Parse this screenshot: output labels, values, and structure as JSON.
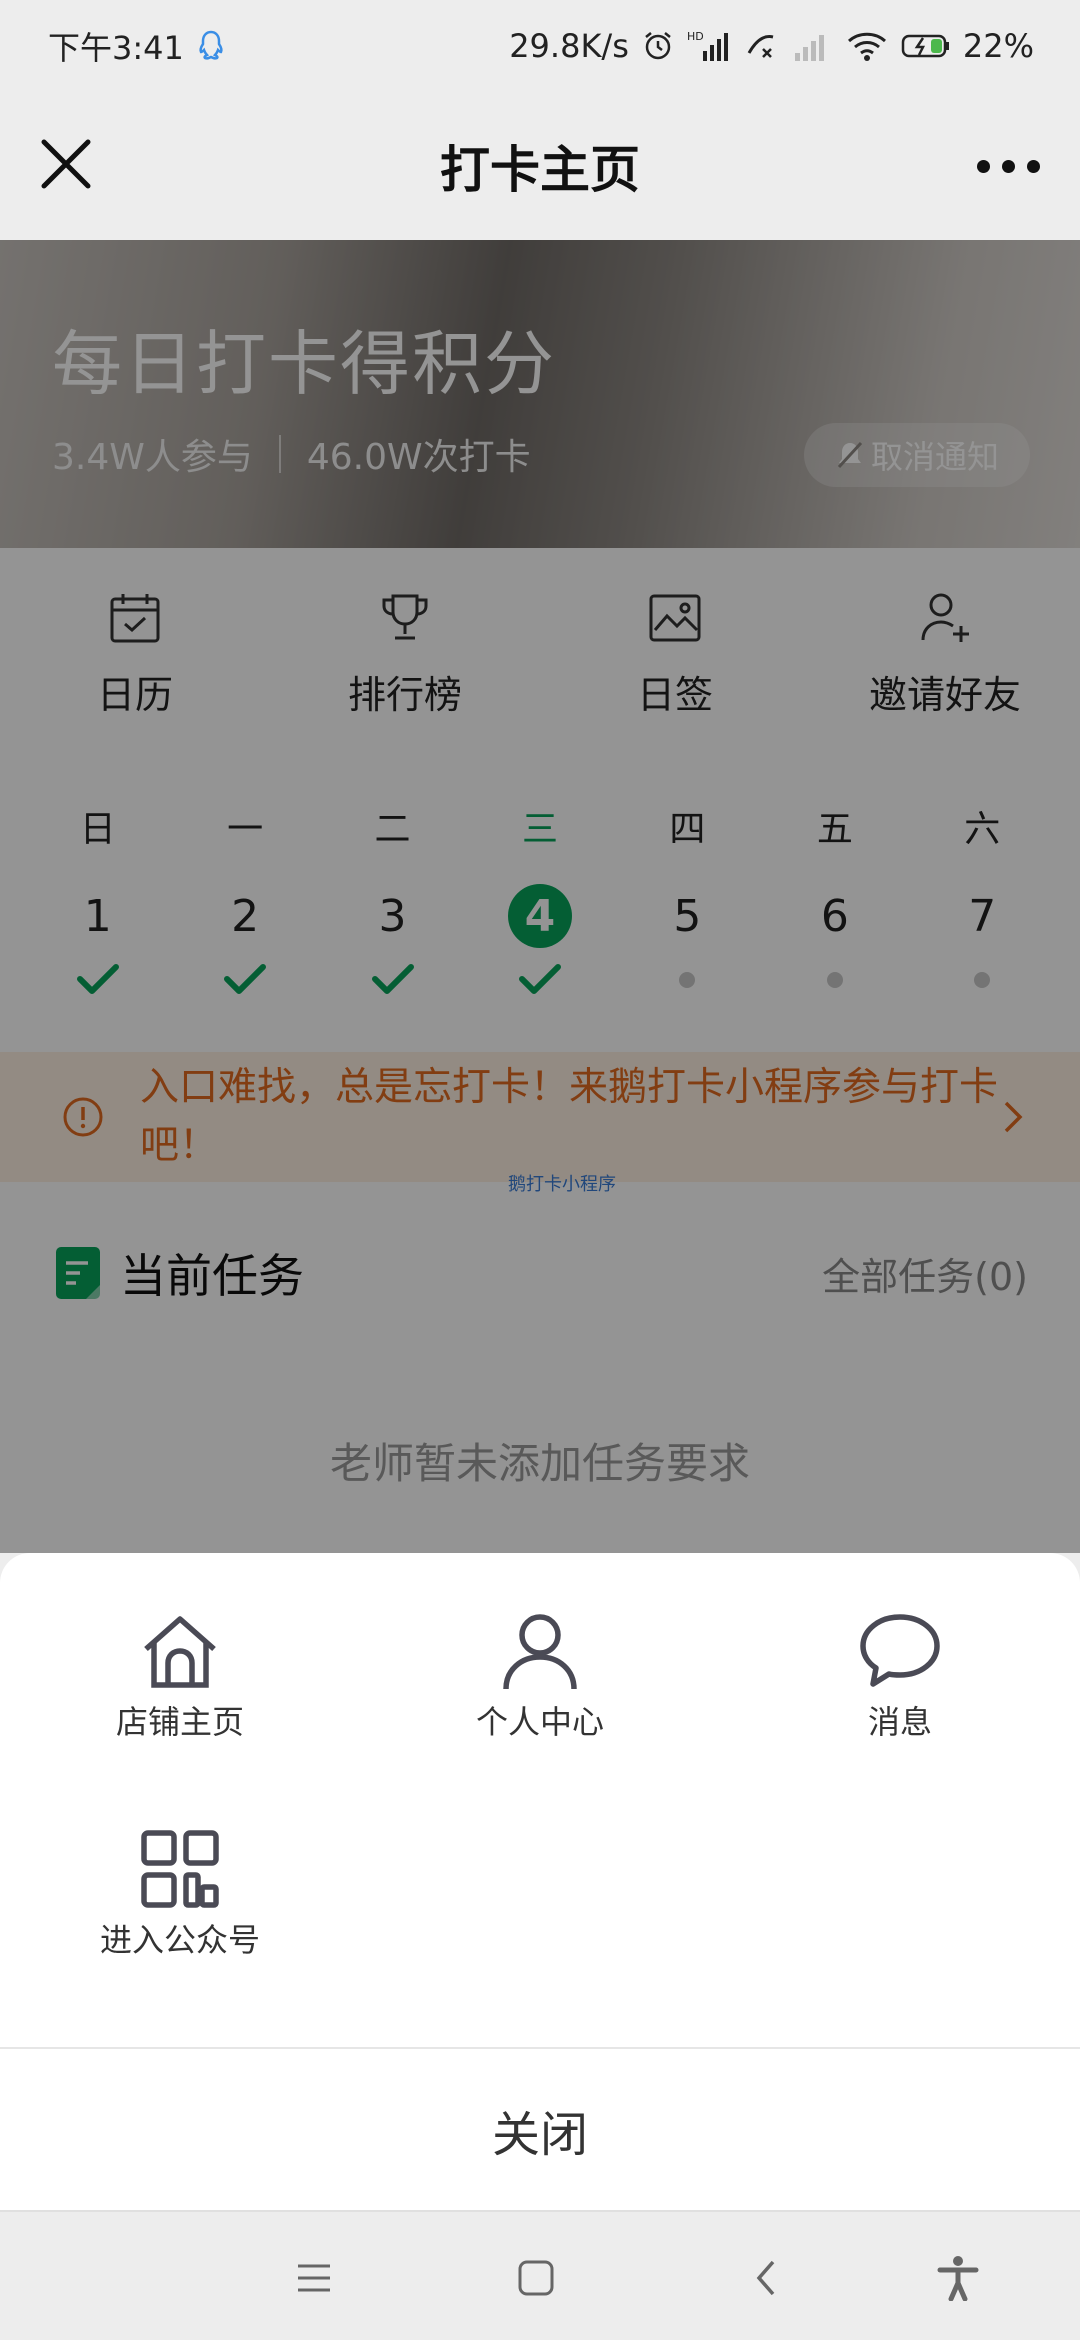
{
  "status_bar": {
    "time": "下午3:41",
    "network_speed": "29.8K/s",
    "battery": "22%",
    "icons": [
      "qq-icon",
      "alarm-icon",
      "hd-signal-icon",
      "call-icon",
      "signal-icon",
      "wifi-icon",
      "battery-charging-icon"
    ]
  },
  "header": {
    "title": "打卡主页"
  },
  "hero": {
    "title": "每日打卡得积分",
    "participants": "3.4W人参与",
    "checkins": "46.0W次打卡",
    "notify_button": "取消通知"
  },
  "shortcuts": [
    {
      "label": "日历",
      "icon": "calendar-icon"
    },
    {
      "label": "排行榜",
      "icon": "trophy-icon"
    },
    {
      "label": "日签",
      "icon": "image-icon"
    },
    {
      "label": "邀请好友",
      "icon": "add-user-icon"
    }
  ],
  "week": {
    "days": [
      {
        "weekday": "日",
        "date": "1",
        "status": "checked"
      },
      {
        "weekday": "一",
        "date": "2",
        "status": "checked"
      },
      {
        "weekday": "二",
        "date": "3",
        "status": "checked"
      },
      {
        "weekday": "三",
        "date": "4",
        "status": "checked",
        "today": true
      },
      {
        "weekday": "四",
        "date": "5",
        "status": "pending"
      },
      {
        "weekday": "五",
        "date": "6",
        "status": "pending"
      },
      {
        "weekday": "六",
        "date": "7",
        "status": "pending"
      }
    ],
    "accent_color": "#07a35a"
  },
  "banner": {
    "text": "入口难找，总是忘打卡！来鹅打卡小程序参与打卡吧！",
    "footnote": "鹅打卡小程序"
  },
  "tasks": {
    "title": "当前任务",
    "all_link": "全部任务(0)",
    "empty_text": "老师暂未添加任务要求"
  },
  "sheet": {
    "items": [
      {
        "label": "店铺主页",
        "icon": "home-icon"
      },
      {
        "label": "个人中心",
        "icon": "person-icon"
      },
      {
        "label": "消息",
        "icon": "message-icon"
      },
      {
        "label": "进入公众号",
        "icon": "qrcode-icon"
      }
    ],
    "close_label": "关闭"
  },
  "nav_bar": {
    "icons": [
      "menu-icon",
      "home-square-icon",
      "back-icon",
      "accessibility-icon"
    ]
  }
}
